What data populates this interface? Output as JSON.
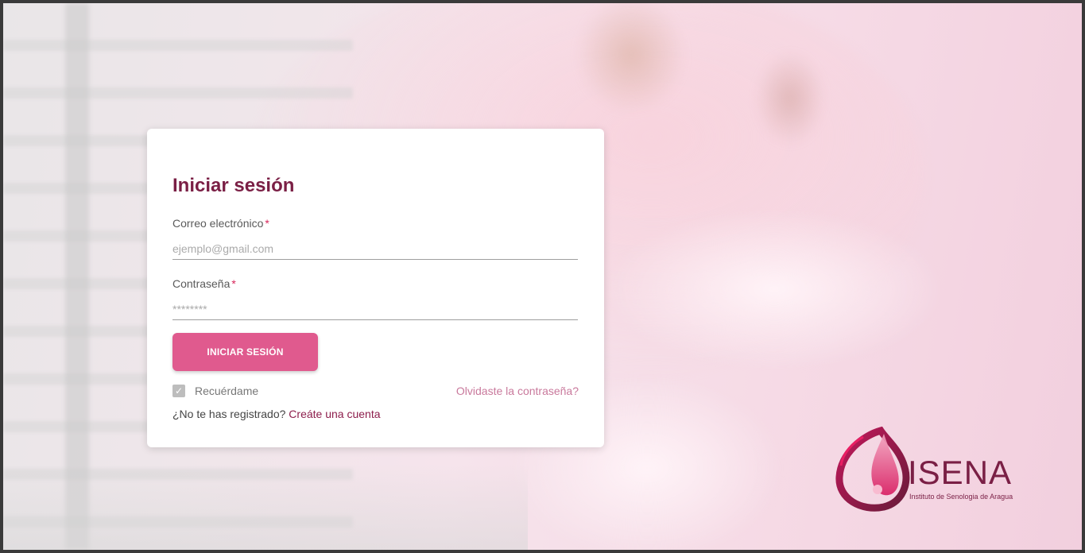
{
  "login": {
    "title": "Iniciar sesión",
    "email_label": "Correo electrónico",
    "email_placeholder": "ejemplo@gmail.com",
    "email_value": "",
    "password_label": "Contraseña",
    "password_placeholder": "********",
    "password_value": "",
    "required_mark": "*",
    "submit_label": "INICIAR SESIÓN",
    "remember_label": "Recuérdame",
    "remember_checked": true,
    "forgot_label": "Olvidaste la contraseña?",
    "register_prompt": "¿No te has registrado?",
    "register_link": "Creáte una cuenta"
  },
  "brand": {
    "name": "ISENA",
    "subtitle": "Instituto de Senologia de Aragua",
    "primary_color": "#7a1f45",
    "accent_color": "#e05a8e"
  },
  "icons": {
    "checkbox": "checkmark-icon",
    "logo": "isena-logo-icon"
  }
}
